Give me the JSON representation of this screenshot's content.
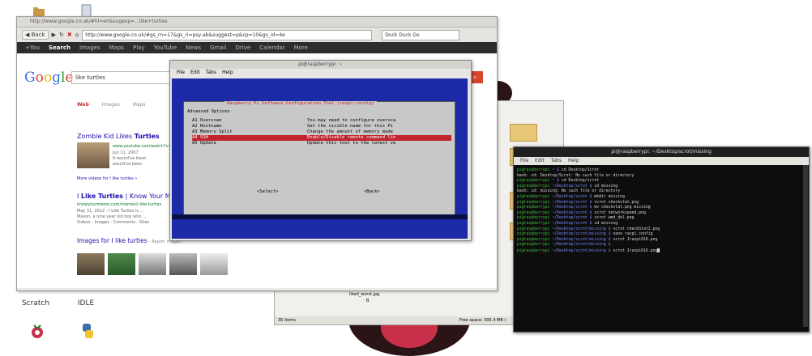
{
  "desktop": {
    "icons": [
      {
        "name": "folder-icon",
        "label": ""
      },
      {
        "name": "file-icon",
        "label": ""
      },
      {
        "name": "scratch-icon",
        "label": "Scratch"
      },
      {
        "name": "idle-icon",
        "label": "IDLE"
      },
      {
        "name": "raspberry-icon",
        "label": ""
      },
      {
        "name": "python-icon",
        "label": ""
      }
    ]
  },
  "browser": {
    "titlebar": "http://www.google.co.uk/#hl=en&sugexp=...like+turtles",
    "nav": {
      "back": "Back",
      "url": "http://www.google.co.uk/#gs_rn=17&gs_ri=psy-ab&suggest=p&cp=10&gs_id=4e",
      "search_engine": "Duck Duck Go"
    },
    "gbar": [
      "+You",
      "Search",
      "Images",
      "Maps",
      "Play",
      "YouTube",
      "News",
      "Gmail",
      "Drive",
      "Calendar",
      "More"
    ],
    "query": "like turtles",
    "logo": "Google",
    "filters": [
      "Web",
      "Images",
      "Maps"
    ],
    "results": [
      {
        "title_pre": "Zombie Kid Likes ",
        "title_hl": "Turtles",
        "url": "www.youtube.com/watch?v=CMNry4PE93Y",
        "snip": [
          "Jun 11, 2007",
          "It would've been",
          "would've been"
        ]
      },
      {
        "title_pre": "I ",
        "title_hl": "Like Turtles",
        "title_post": " | Know Your Meme",
        "url": "knowyourmeme.com/memes/i-like-turtles",
        "snip": [
          "May 31, 2012 - I Like Turtles is ...",
          "Mason, a nine year old boy who ...",
          "Videos - Images - Comments - Sites"
        ]
      }
    ],
    "more_videos": "More videos for I like turtles »",
    "images_link": "Images for I like turtles",
    "report_images": "- Report images"
  },
  "raspi": {
    "title": "pi@raspberrypi: ~",
    "menu": [
      "File",
      "Edit",
      "Tabs",
      "Help"
    ],
    "dialog_title": "Raspberry Pi Software Configuration Tool (raspi-config)",
    "subtitle": "Advanced Options",
    "options": [
      {
        "key": "A1 Overscan",
        "desc": "You may need to configure oversca"
      },
      {
        "key": "A2 Hostname",
        "desc": "Set the visible name for this Pi"
      },
      {
        "key": "A3 Memory Split",
        "desc": "Change the amount of memory made"
      },
      {
        "key": "A4 SSH",
        "desc": "Enable/Disable remote command lin"
      },
      {
        "key": "A5 Update",
        "desc": "Update this tool to the latest ve"
      }
    ],
    "select": "<Select>",
    "back": "<Back>"
  },
  "files": {
    "status_left": "35 items",
    "status_right": "Free space: 395.4 MB (",
    "file_label": "liked_worst.jpg",
    "file_sub": "B"
  },
  "terminal": {
    "title": "pi@raspberrypi: ~/Desktop/scrot/missing",
    "menu": [
      "File",
      "Edit",
      "Tabs",
      "Help"
    ],
    "lines": [
      {
        "p": "pi@raspberrypi",
        "d": " ~ $ ",
        "t": "cd Desktop/Scrot"
      },
      {
        "p": "",
        "d": "",
        "t": "bash: cd: Desktop/Scrot: No such file or directory"
      },
      {
        "p": "pi@raspberrypi",
        "d": " ~ $ ",
        "t": "cd Desktop/scrot"
      },
      {
        "p": "pi@raspberrypi",
        "d": " ~/Desktop/scrot $ ",
        "t": "cd missing"
      },
      {
        "p": "",
        "d": "",
        "t": "bash: cd: missing: No such file or directory"
      },
      {
        "p": "pi@raspberrypi",
        "d": " ~/Desktop/scrot $ ",
        "t": "mkdir missing"
      },
      {
        "p": "pi@raspberrypi",
        "d": " ~/Desktop/scrot $ ",
        "t": "scrot checkstat.png"
      },
      {
        "p": "pi@raspberrypi",
        "d": " ~/Desktop/scrot $ ",
        "t": "mv checkstat.png missing"
      },
      {
        "p": "pi@raspberrypi",
        "d": " ~/Desktop/scrot $ ",
        "t": "scrot networkspeed.png"
      },
      {
        "p": "pi@raspberrypi",
        "d": " ~/Desktop/scrot $ ",
        "t": "scrot wmd_del.png"
      },
      {
        "p": "pi@raspberrypi",
        "d": " ~/Desktop/scrot $ ",
        "t": "cd missing"
      },
      {
        "p": "pi@raspberrypi",
        "d": " ~/Desktop/scrot/missing $ ",
        "t": "scrot checkStat2.png"
      },
      {
        "p": "pi@raspberrypi",
        "d": " ~/Desktop/scrot/missing $ ",
        "t": "nano raspi.config"
      },
      {
        "p": "pi@raspberrypi",
        "d": " ~/Desktop/scrot/missing $ ",
        "t": "scrot Jraspi616.png"
      },
      {
        "p": "pi@raspberrypi",
        "d": " ~/Desktop/scrot/missing $ ",
        "t": ""
      },
      {
        "p": "pi@raspberrypi",
        "d": " ~/Desktop/scrot/missing $ ",
        "t": "scrot Jraspi616.png"
      }
    ]
  }
}
